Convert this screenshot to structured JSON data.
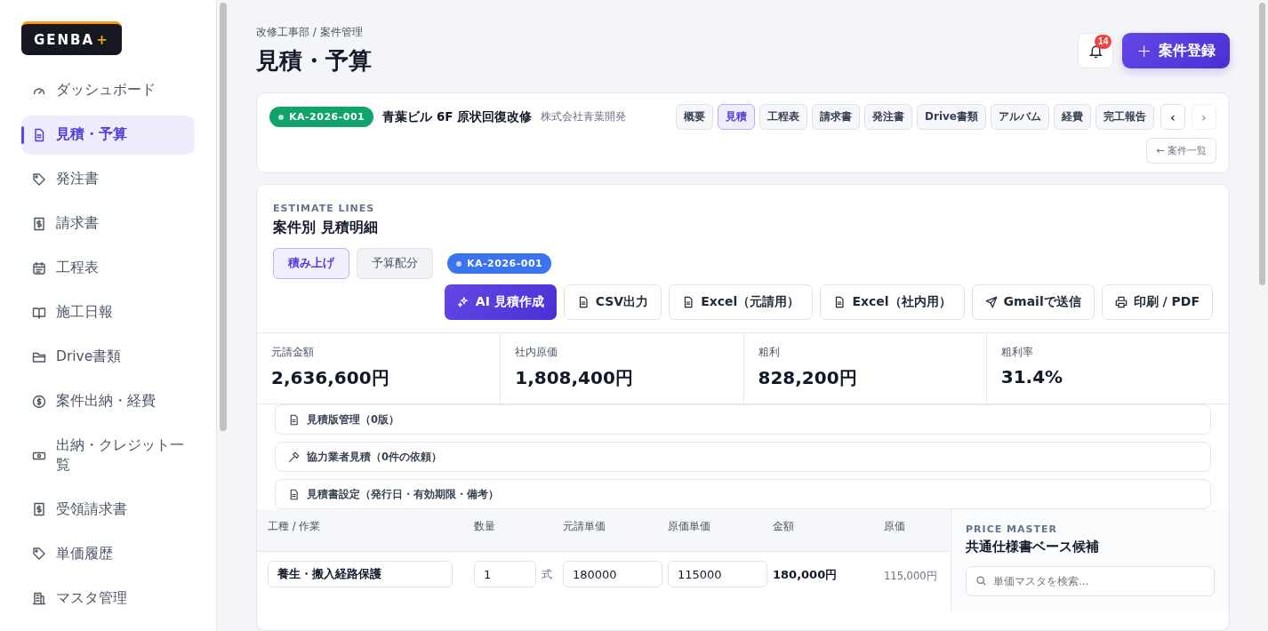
{
  "logo": {
    "text": "GENBA",
    "mark": "+"
  },
  "sidebar": {
    "items": [
      {
        "label": "ダッシュボード",
        "kind": "gauge",
        "selected": false
      },
      {
        "label": "見積・予算",
        "kind": "doc",
        "selected": true
      },
      {
        "label": "発注書",
        "kind": "tag",
        "selected": false
      },
      {
        "label": "請求書",
        "kind": "receipt",
        "selected": false
      },
      {
        "label": "工程表",
        "kind": "calendar",
        "selected": false
      },
      {
        "label": "施工日報",
        "kind": "book",
        "selected": false
      },
      {
        "label": "Drive書類",
        "kind": "folder",
        "selected": false
      },
      {
        "label": "案件出納・経費",
        "kind": "coin",
        "selected": false
      },
      {
        "label": "出納・クレジット一覧",
        "kind": "cash",
        "selected": false
      },
      {
        "label": "受領請求書",
        "kind": "receipt",
        "selected": false
      },
      {
        "label": "単価履歴",
        "kind": "tag",
        "selected": false
      },
      {
        "label": "マスタ管理",
        "kind": "building",
        "selected": false
      }
    ]
  },
  "breadcrumb": "改修工事部 / 案件管理",
  "page_title": "見積・予算",
  "notifications": {
    "count": "14"
  },
  "primary_button": {
    "icon": "+",
    "label": "案件登録"
  },
  "project": {
    "code": "KA-2026-001",
    "name": "青葉ビル 6F 原状回復改修",
    "client": "株式会社青葉開発",
    "tabs": [
      {
        "label": "概要",
        "selected": false
      },
      {
        "label": "見積",
        "selected": true
      },
      {
        "label": "工程表",
        "selected": false
      },
      {
        "label": "請求書",
        "selected": false
      },
      {
        "label": "発注書",
        "selected": false
      },
      {
        "label": "Drive書類",
        "selected": false
      },
      {
        "label": "アルバム",
        "selected": false
      },
      {
        "label": "経費",
        "selected": false
      },
      {
        "label": "完工報告",
        "selected": false
      }
    ],
    "prev": {
      "label": "‹",
      "disabled": false
    },
    "next": {
      "label": "›",
      "disabled": true
    },
    "back_link": "← 案件一覧"
  },
  "estimate": {
    "eyebrow": "ESTIMATE LINES",
    "title": "案件別 見積明細",
    "modes": [
      {
        "label": "積み上げ",
        "selected": true
      },
      {
        "label": "予算配分",
        "selected": false
      }
    ],
    "code_badge": "KA-2026-001",
    "actions": [
      {
        "label": "AI 見積作成",
        "kind": "ai"
      },
      {
        "label": "CSV出力",
        "kind": "file"
      },
      {
        "label": "Excel（元請用）",
        "kind": "file"
      },
      {
        "label": "Excel（社内用）",
        "kind": "file"
      },
      {
        "label": "Gmailで送信",
        "kind": "send"
      },
      {
        "label": "印刷 / PDF",
        "kind": "print"
      }
    ],
    "metrics": [
      {
        "label": "元請金額",
        "value": "2,636,600円"
      },
      {
        "label": "社内原価",
        "value": "1,808,400円"
      },
      {
        "label": "粗利",
        "value": "828,200円"
      },
      {
        "label": "粗利率",
        "value": "31.4%"
      }
    ],
    "panels": [
      {
        "label": "見積版管理（0版）",
        "kind": "file"
      },
      {
        "label": "協力業者見積（0件の依頼）",
        "kind": "tool"
      },
      {
        "label": "見積書設定（発行日・有効期限・備考）",
        "kind": "file"
      }
    ],
    "table": {
      "columns": [
        "工種 / 作業",
        "数量",
        "元請単価",
        "原価単価",
        "金額",
        "原価"
      ],
      "rows": [
        {
          "work": "養生・搬入経路保護",
          "qty": "1",
          "unit": "式",
          "price": "180000",
          "cost": "115000",
          "amount": "180,000円",
          "cost_total": "115,000円"
        }
      ]
    },
    "price_master": {
      "eyebrow": "PRICE MASTER",
      "title": "共通仕様書ベース候補",
      "search_placeholder": "単価マスタを検索..."
    }
  }
}
